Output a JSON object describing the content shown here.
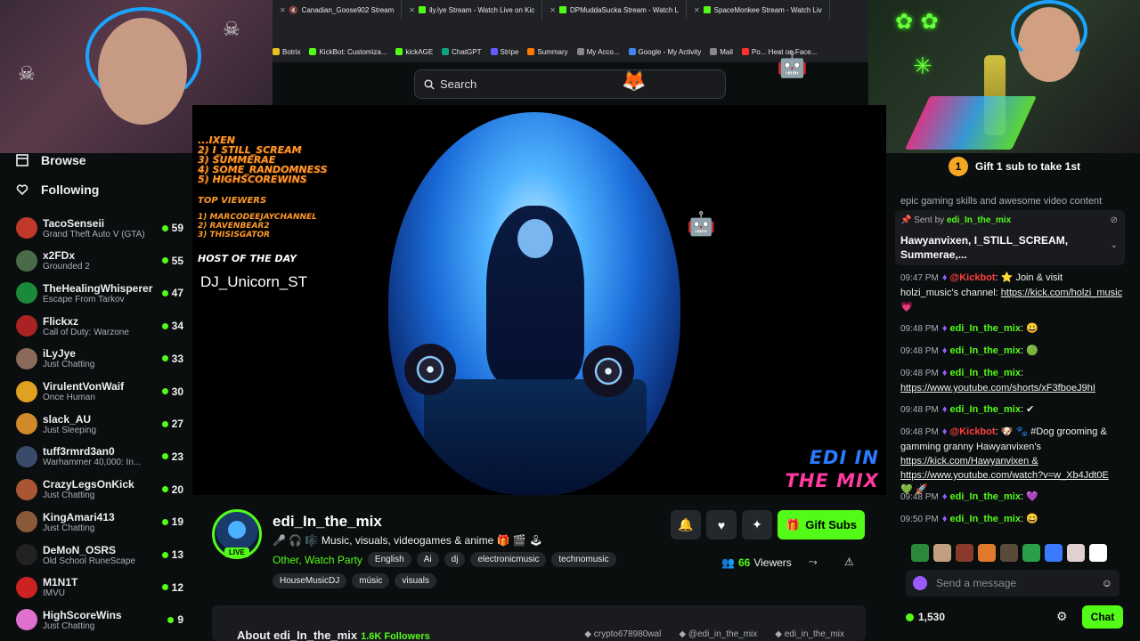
{
  "browser": {
    "tabs": [
      {
        "label": "Canadian_Goose902 Stream"
      },
      {
        "label": "ily.lye Stream - Watch Live on Kic"
      },
      {
        "label": "DPMuddaSucka Stream - Watch L"
      },
      {
        "label": "SpaceMonkee Stream - Watch Liv"
      }
    ],
    "bookmarks": [
      {
        "label": "Botrix",
        "color": "#e8c020"
      },
      {
        "label": "KickBot: Customiza...",
        "color": "#53fc18"
      },
      {
        "label": "kickAGE",
        "color": "#53fc18"
      },
      {
        "label": "ChatGPT",
        "color": "#10a37f"
      },
      {
        "label": "Stripe",
        "color": "#635bff"
      },
      {
        "label": "Summary",
        "color": "#ff7a00"
      },
      {
        "label": "My Acco...",
        "color": "#888888"
      },
      {
        "label": "Google - My Activity",
        "color": "#4285f4"
      },
      {
        "label": "Mail",
        "color": "#888888"
      },
      {
        "label": "Po... Heat on Face...",
        "color": "#ff3030"
      }
    ]
  },
  "topbar": {
    "search_placeholder": "Search"
  },
  "sidebar": {
    "browse": "Browse",
    "following": "Following",
    "channels": [
      {
        "name": "TacoSenseii",
        "game": "Grand Theft Auto V (GTA)",
        "viewers": "59",
        "color": "#c0392b"
      },
      {
        "name": "x2FDx",
        "game": "Grounded 2",
        "viewers": "55",
        "color": "#4a6a4a"
      },
      {
        "name": "TheHealingWhisperer",
        "game": "Escape From Tarkov",
        "viewers": "47",
        "color": "#1a8a3a"
      },
      {
        "name": "Flickxz",
        "game": "Call of Duty: Warzone",
        "viewers": "34",
        "color": "#aa2222"
      },
      {
        "name": "iLyJye",
        "game": "Just Chatting",
        "viewers": "33",
        "color": "#8a6a5a"
      },
      {
        "name": "VirulentVonWaif",
        "game": "Once Human",
        "viewers": "30",
        "color": "#e0a020"
      },
      {
        "name": "slack_AU",
        "game": "Just Sleeping",
        "viewers": "27",
        "color": "#d08a2a"
      },
      {
        "name": "tuff3rmrd3an0",
        "game": "Warhammer 40,000: In...",
        "viewers": "23",
        "color": "#3a4a6a"
      },
      {
        "name": "CrazyLegsOnKick",
        "game": "Just Chatting",
        "viewers": "20",
        "color": "#aa5533"
      },
      {
        "name": "KingAmari413",
        "game": "Just Chatting",
        "viewers": "19",
        "color": "#8a5a3a"
      },
      {
        "name": "DeMoN_OSRS",
        "game": "Old School RuneScape",
        "viewers": "13",
        "color": "#222222"
      },
      {
        "name": "M1N1T",
        "game": "IMVU",
        "viewers": "12",
        "color": "#cc2222"
      },
      {
        "name": "HighScoreWins",
        "game": "Just Chatting",
        "viewers": "9",
        "color": "#e070d0"
      }
    ]
  },
  "overlay": {
    "top_list": [
      "...IXEN",
      "2) I_STILL_SCREAM",
      "3) SUMMERAE",
      "4) SOME_RANDOMNESS",
      "5) HIGHSCOREWINS"
    ],
    "top_viewers_heading": "TOP VIEWERS",
    "top_viewers": [
      "1) MARCODEEJAYCHANNEL",
      "2) RAVENBEAR2",
      "3) THISISGATOR"
    ],
    "host_heading": "HOST OF THE DAY",
    "host_name": "DJ_Unicorn_ST",
    "logo_line1": "EDI IN",
    "logo_line2": "THE MIX"
  },
  "channel": {
    "name": "edi_In_the_mix",
    "live": "LIVE",
    "title": "🎤 🎧 🎼 Music,  visuals, videogames & anime 🎁 🎬 🕹",
    "category": "Other, Watch Party",
    "tags": [
      "English",
      "Ai",
      "dj",
      "electronicmusic",
      "technomusic"
    ],
    "tags2": [
      "HouseMusicDJ",
      "músic",
      "visuals"
    ],
    "gift_label": "Gift Subs",
    "viewers_count": "66",
    "viewers_label": "Viewers",
    "about": "About edi_In_the_mix",
    "followers": "1.6K Followers",
    "socials": [
      "crypto678980wal",
      "@edi_in_the_mix",
      "edi_in_the_mix"
    ]
  },
  "chat": {
    "gift_banner": "Gift 1 sub to take 1st",
    "gift_rank": "1",
    "pinned_top": "epic gaming skills and awesome video content",
    "pinned_sent_by": "Sent by",
    "pinned_user": "edi_In_the_mix",
    "pinned_text": "Hawyanvixen, I_STILL_SCREAM, Summerae,...",
    "messages": [
      {
        "time": "09:47 PM",
        "user": "@Kickbot",
        "text": ": ⭐ Join & visit holzi_music's channel:",
        "link": "https://kick.com/holzi_music",
        "extra": " 💗",
        "lines": 3,
        "red": true
      },
      {
        "time": "09:48 PM",
        "user": "edi_In_the_mix",
        "text": ": 😀",
        "link": "",
        "extra": "",
        "lines": 1,
        "red": false
      },
      {
        "time": "09:48 PM",
        "user": "edi_In_the_mix",
        "text": ": 🟢",
        "link": "",
        "extra": "",
        "lines": 1,
        "red": false
      },
      {
        "time": "09:48 PM",
        "user": "edi_In_the_mix",
        "text": ":",
        "link": "https://www.youtube.com/shorts/xF3fboeJ9hI",
        "extra": "",
        "lines": 2,
        "red": false
      },
      {
        "time": "09:48 PM",
        "user": "edi_In_the_mix",
        "text": ": ✔",
        "link": "",
        "extra": "",
        "lines": 1,
        "red": false
      },
      {
        "time": "09:48 PM",
        "user": "@Kickbot",
        "text": ": 🐶 🐾 #Dog grooming & gamming granny Hawyanvixen's",
        "link": "https://kick.com/Hawyanvixen & https://www.youtube.com/watch?v=w_Xb4Jdt0E",
        "extra": " 💚 🚀",
        "lines": 4,
        "red": true
      },
      {
        "time": "09:48 PM",
        "user": "edi_In_the_mix",
        "text": ": 💜",
        "link": "",
        "extra": "",
        "lines": 1,
        "red": false
      },
      {
        "time": "09:50 PM",
        "user": "edi_In_the_mix",
        "text": ": 😀",
        "link": "",
        "extra": "",
        "lines": 1,
        "red": false
      }
    ],
    "send_placeholder": "Send a message",
    "points": "1,530",
    "chat_button": "Chat"
  }
}
